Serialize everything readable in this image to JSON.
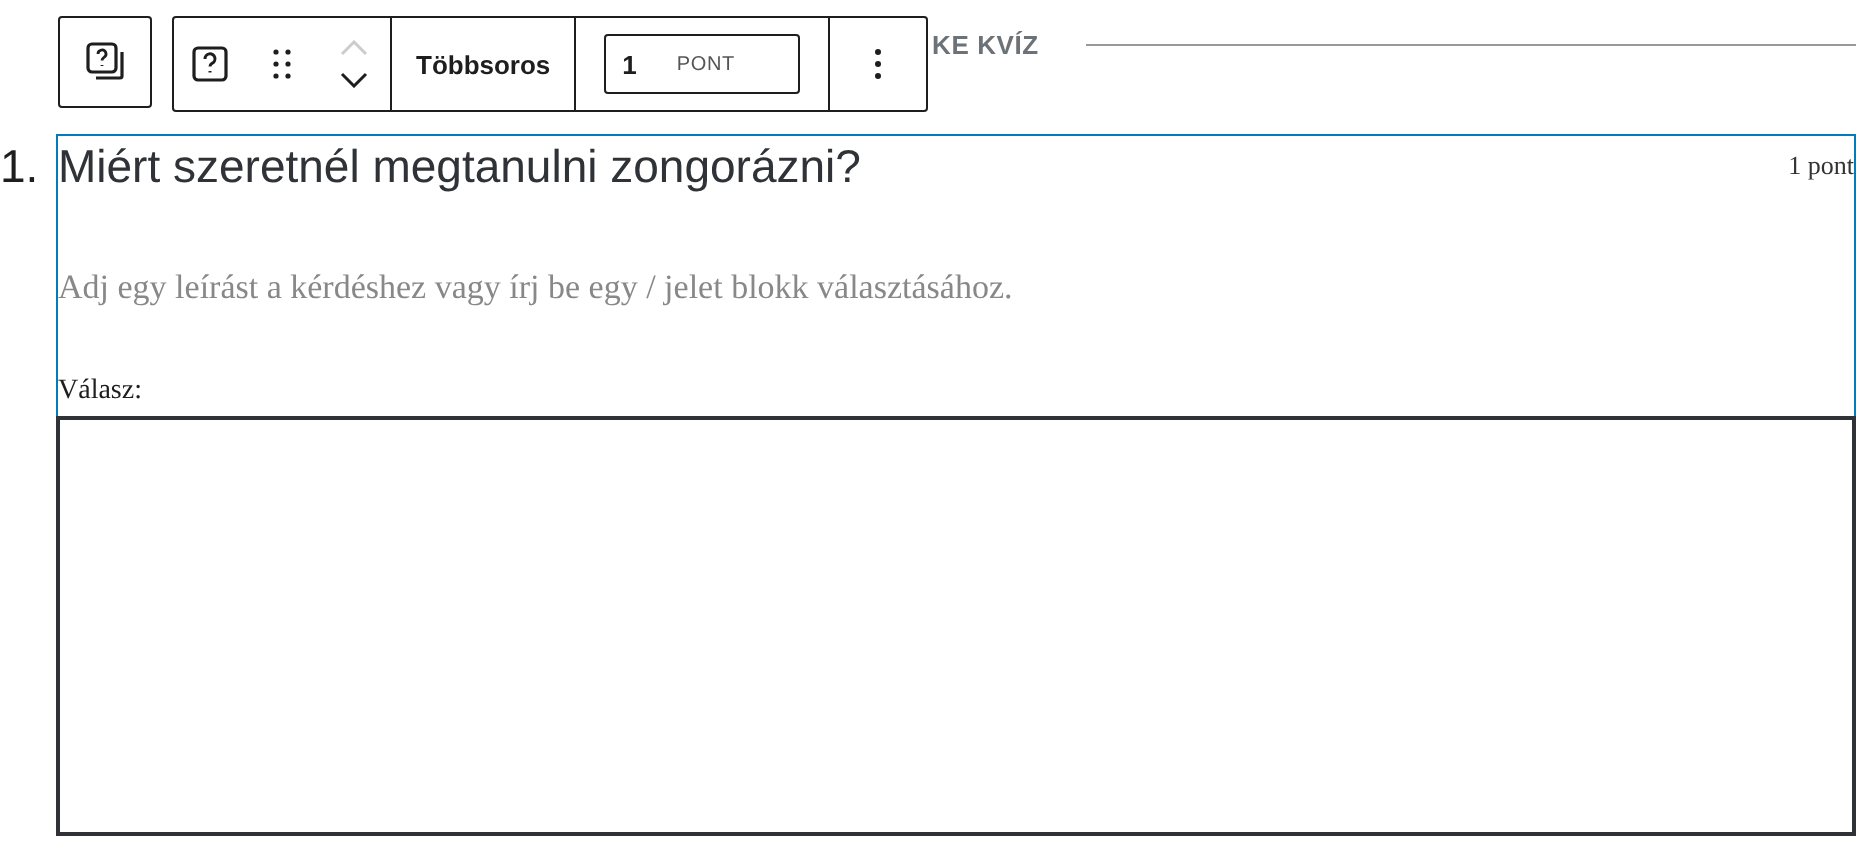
{
  "section_heading": "KE KVÍZ",
  "toolbar": {
    "type_label": "Többsoros",
    "points_value": "1",
    "points_unit": "PONT",
    "move_up_disabled": true,
    "move_down_disabled": false
  },
  "question": {
    "number": "1.",
    "title": "Miért szeretnél megtanulni zongorázni?",
    "points": "1 pont",
    "description_placeholder": "Adj egy leírást a kérdéshez vagy írj be egy / jelet blokk választásához.",
    "answer_label": "Válasz:",
    "selected": true
  }
}
